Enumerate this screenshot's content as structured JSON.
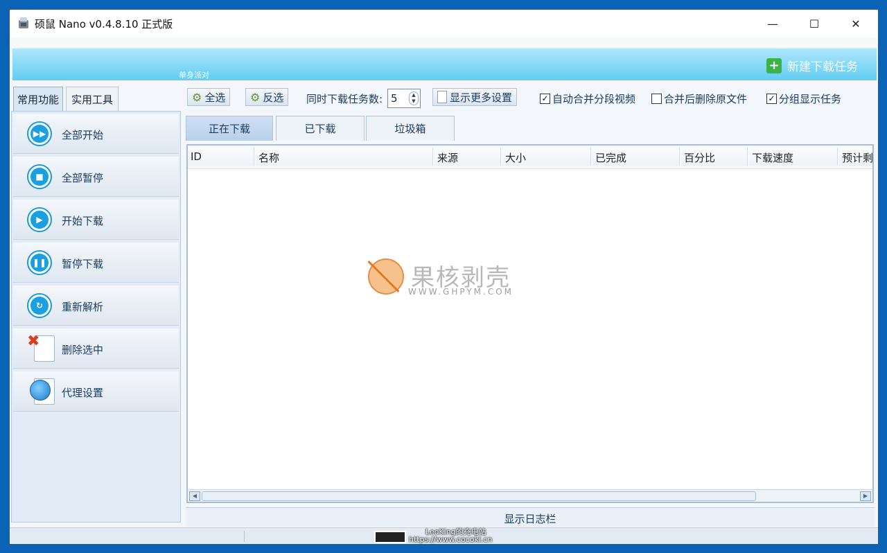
{
  "window": {
    "title": "硕鼠 Nano v0.4.8.10 正式版",
    "minimize": "—",
    "maximize": "☐",
    "close": "✕"
  },
  "banner": {
    "subtitle": "单身派对",
    "new_task_label": "新建下载任务"
  },
  "sidebar": {
    "tabs": [
      {
        "label": "常用功能",
        "active": true
      },
      {
        "label": "实用工具",
        "active": false
      }
    ],
    "items": [
      {
        "label": "全部开始",
        "icon": "fast-forward-icon"
      },
      {
        "label": "全部暂停",
        "icon": "stop-icon"
      },
      {
        "label": "开始下载",
        "icon": "play-icon"
      },
      {
        "label": "暂停下载",
        "icon": "pause-icon"
      },
      {
        "label": "重新解析",
        "icon": "refresh-icon"
      },
      {
        "label": "删除选中",
        "icon": "delete-document-icon"
      },
      {
        "label": "代理设置",
        "icon": "globe-icon"
      }
    ]
  },
  "toolbar": {
    "select_all": "全选",
    "invert_select": "反选",
    "concurrent_label": "同时下载任务数:",
    "concurrent_value": "5",
    "more_settings": "显示更多设置",
    "options": [
      {
        "label": "自动合并分段视频",
        "checked": true
      },
      {
        "label": "合并后删除原文件",
        "checked": false
      },
      {
        "label": "分组显示任务",
        "checked": true
      }
    ]
  },
  "main_tabs": [
    {
      "label": "正在下载",
      "active": true
    },
    {
      "label": "已下载",
      "active": false
    },
    {
      "label": "垃圾箱",
      "active": false
    }
  ],
  "table": {
    "columns": [
      "ID",
      "名称",
      "来源",
      "大小",
      "已完成",
      "百分比",
      "下载速度",
      "预计剩"
    ]
  },
  "watermark": {
    "title": "果核剥壳",
    "url": "WWW.GHPYM.COM"
  },
  "log_bar_label": "显示日志栏",
  "overlay": {
    "line1": "LeoKing的充电站",
    "line2": "https://www.cocokl.cn"
  },
  "colors": {
    "accent": "#1aa0e0",
    "banner": "#62cdf2",
    "desktop": "#0b63b5"
  }
}
